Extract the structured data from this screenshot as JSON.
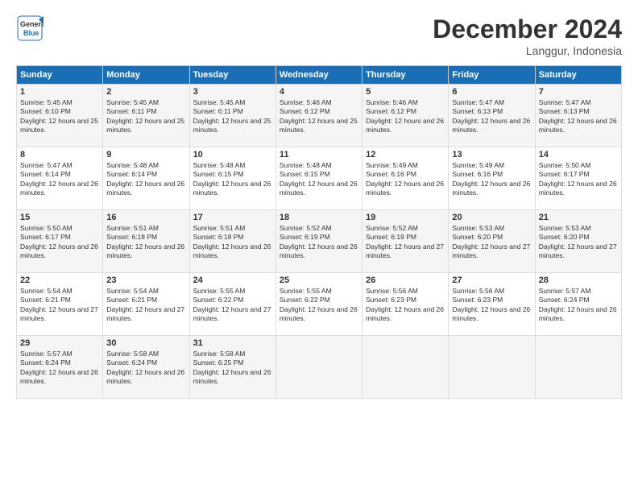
{
  "logo": {
    "line1": "General",
    "line2": "Blue"
  },
  "title": "December 2024",
  "location": "Langgur, Indonesia",
  "header_days": [
    "Sunday",
    "Monday",
    "Tuesday",
    "Wednesday",
    "Thursday",
    "Friday",
    "Saturday"
  ],
  "weeks": [
    [
      {
        "day": "1",
        "sunrise": "Sunrise: 5:45 AM",
        "sunset": "Sunset: 6:10 PM",
        "daylight": "Daylight: 12 hours and 25 minutes."
      },
      {
        "day": "2",
        "sunrise": "Sunrise: 5:45 AM",
        "sunset": "Sunset: 6:11 PM",
        "daylight": "Daylight: 12 hours and 25 minutes."
      },
      {
        "day": "3",
        "sunrise": "Sunrise: 5:45 AM",
        "sunset": "Sunset: 6:11 PM",
        "daylight": "Daylight: 12 hours and 25 minutes."
      },
      {
        "day": "4",
        "sunrise": "Sunrise: 5:46 AM",
        "sunset": "Sunset: 6:12 PM",
        "daylight": "Daylight: 12 hours and 25 minutes."
      },
      {
        "day": "5",
        "sunrise": "Sunrise: 5:46 AM",
        "sunset": "Sunset: 6:12 PM",
        "daylight": "Daylight: 12 hours and 26 minutes."
      },
      {
        "day": "6",
        "sunrise": "Sunrise: 5:47 AM",
        "sunset": "Sunset: 6:13 PM",
        "daylight": "Daylight: 12 hours and 26 minutes."
      },
      {
        "day": "7",
        "sunrise": "Sunrise: 5:47 AM",
        "sunset": "Sunset: 6:13 PM",
        "daylight": "Daylight: 12 hours and 26 minutes."
      }
    ],
    [
      {
        "day": "8",
        "sunrise": "Sunrise: 5:47 AM",
        "sunset": "Sunset: 6:14 PM",
        "daylight": "Daylight: 12 hours and 26 minutes."
      },
      {
        "day": "9",
        "sunrise": "Sunrise: 5:48 AM",
        "sunset": "Sunset: 6:14 PM",
        "daylight": "Daylight: 12 hours and 26 minutes."
      },
      {
        "day": "10",
        "sunrise": "Sunrise: 5:48 AM",
        "sunset": "Sunset: 6:15 PM",
        "daylight": "Daylight: 12 hours and 26 minutes."
      },
      {
        "day": "11",
        "sunrise": "Sunrise: 5:48 AM",
        "sunset": "Sunset: 6:15 PM",
        "daylight": "Daylight: 12 hours and 26 minutes."
      },
      {
        "day": "12",
        "sunrise": "Sunrise: 5:49 AM",
        "sunset": "Sunset: 6:16 PM",
        "daylight": "Daylight: 12 hours and 26 minutes."
      },
      {
        "day": "13",
        "sunrise": "Sunrise: 5:49 AM",
        "sunset": "Sunset: 6:16 PM",
        "daylight": "Daylight: 12 hours and 26 minutes."
      },
      {
        "day": "14",
        "sunrise": "Sunrise: 5:50 AM",
        "sunset": "Sunset: 6:17 PM",
        "daylight": "Daylight: 12 hours and 26 minutes."
      }
    ],
    [
      {
        "day": "15",
        "sunrise": "Sunrise: 5:50 AM",
        "sunset": "Sunset: 6:17 PM",
        "daylight": "Daylight: 12 hours and 26 minutes."
      },
      {
        "day": "16",
        "sunrise": "Sunrise: 5:51 AM",
        "sunset": "Sunset: 6:18 PM",
        "daylight": "Daylight: 12 hours and 26 minutes."
      },
      {
        "day": "17",
        "sunrise": "Sunrise: 5:51 AM",
        "sunset": "Sunset: 6:18 PM",
        "daylight": "Daylight: 12 hours and 26 minutes."
      },
      {
        "day": "18",
        "sunrise": "Sunrise: 5:52 AM",
        "sunset": "Sunset: 6:19 PM",
        "daylight": "Daylight: 12 hours and 26 minutes."
      },
      {
        "day": "19",
        "sunrise": "Sunrise: 5:52 AM",
        "sunset": "Sunset: 6:19 PM",
        "daylight": "Daylight: 12 hours and 27 minutes."
      },
      {
        "day": "20",
        "sunrise": "Sunrise: 5:53 AM",
        "sunset": "Sunset: 6:20 PM",
        "daylight": "Daylight: 12 hours and 27 minutes."
      },
      {
        "day": "21",
        "sunrise": "Sunrise: 5:53 AM",
        "sunset": "Sunset: 6:20 PM",
        "daylight": "Daylight: 12 hours and 27 minutes."
      }
    ],
    [
      {
        "day": "22",
        "sunrise": "Sunrise: 5:54 AM",
        "sunset": "Sunset: 6:21 PM",
        "daylight": "Daylight: 12 hours and 27 minutes."
      },
      {
        "day": "23",
        "sunrise": "Sunrise: 5:54 AM",
        "sunset": "Sunset: 6:21 PM",
        "daylight": "Daylight: 12 hours and 27 minutes."
      },
      {
        "day": "24",
        "sunrise": "Sunrise: 5:55 AM",
        "sunset": "Sunset: 6:22 PM",
        "daylight": "Daylight: 12 hours and 27 minutes."
      },
      {
        "day": "25",
        "sunrise": "Sunrise: 5:55 AM",
        "sunset": "Sunset: 6:22 PM",
        "daylight": "Daylight: 12 hours and 26 minutes."
      },
      {
        "day": "26",
        "sunrise": "Sunrise: 5:56 AM",
        "sunset": "Sunset: 6:23 PM",
        "daylight": "Daylight: 12 hours and 26 minutes."
      },
      {
        "day": "27",
        "sunrise": "Sunrise: 5:56 AM",
        "sunset": "Sunset: 6:23 PM",
        "daylight": "Daylight: 12 hours and 26 minutes."
      },
      {
        "day": "28",
        "sunrise": "Sunrise: 5:57 AM",
        "sunset": "Sunset: 6:24 PM",
        "daylight": "Daylight: 12 hours and 26 minutes."
      }
    ],
    [
      {
        "day": "29",
        "sunrise": "Sunrise: 5:57 AM",
        "sunset": "Sunset: 6:24 PM",
        "daylight": "Daylight: 12 hours and 26 minutes."
      },
      {
        "day": "30",
        "sunrise": "Sunrise: 5:58 AM",
        "sunset": "Sunset: 6:24 PM",
        "daylight": "Daylight: 12 hours and 26 minutes."
      },
      {
        "day": "31",
        "sunrise": "Sunrise: 5:58 AM",
        "sunset": "Sunset: 6:25 PM",
        "daylight": "Daylight: 12 hours and 26 minutes."
      },
      null,
      null,
      null,
      null
    ]
  ]
}
